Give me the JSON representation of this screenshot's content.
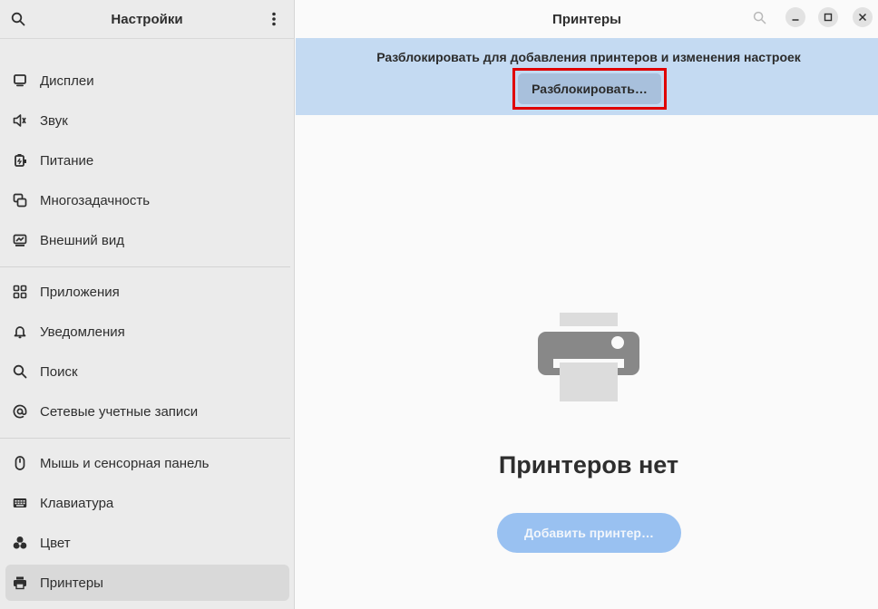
{
  "sidebar": {
    "title": "Настройки",
    "groups": [
      [
        {
          "label": "Дисплеи",
          "icon": "display-icon"
        },
        {
          "label": "Звук",
          "icon": "speaker-icon"
        },
        {
          "label": "Питание",
          "icon": "power-icon"
        },
        {
          "label": "Многозадачность",
          "icon": "multitasking-icon"
        },
        {
          "label": "Внешний вид",
          "icon": "appearance-icon"
        }
      ],
      [
        {
          "label": "Приложения",
          "icon": "apps-icon"
        },
        {
          "label": "Уведомления",
          "icon": "bell-icon"
        },
        {
          "label": "Поиск",
          "icon": "search-icon"
        },
        {
          "label": "Сетевые учетные записи",
          "icon": "at-icon"
        }
      ],
      [
        {
          "label": "Мышь и сенсорная панель",
          "icon": "mouse-icon"
        },
        {
          "label": "Клавиатура",
          "icon": "keyboard-icon"
        },
        {
          "label": "Цвет",
          "icon": "color-icon"
        },
        {
          "label": "Принтеры",
          "icon": "printer-icon",
          "active": true
        }
      ]
    ]
  },
  "main": {
    "title": "Принтеры",
    "banner": {
      "text": "Разблокировать для добавления принтеров и изменения настроек",
      "unlock_label": "Разблокировать…"
    },
    "empty_title": "Принтеров нет",
    "add_label": "Добавить принтер…"
  },
  "colors": {
    "banner_bg": "#c4daf2",
    "unlock_btn_bg": "#a8c0dc",
    "highlight_frame": "#e00000",
    "add_btn_bg": "#99c1f1",
    "sidebar_active": "#d9d9d9"
  }
}
